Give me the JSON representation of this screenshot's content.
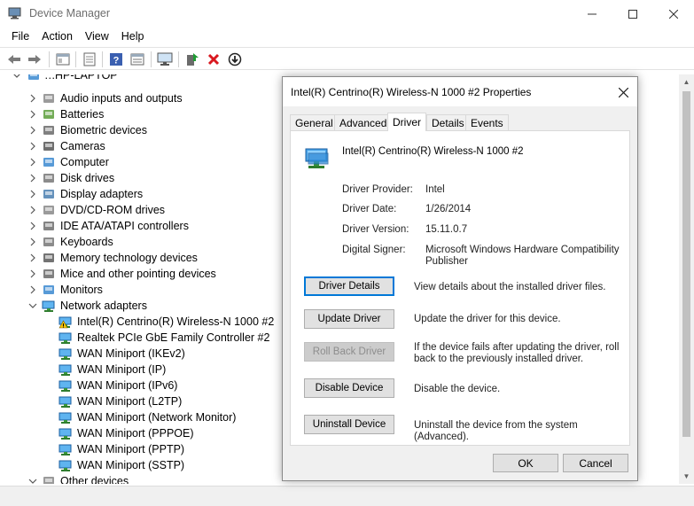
{
  "window": {
    "title": "Device Manager"
  },
  "menu": [
    "File",
    "Action",
    "View",
    "Help"
  ],
  "toolbar_icons": [
    "back-icon",
    "forward-icon",
    "show-hide-icon",
    "properties-icon",
    "help-icon",
    "view-icon",
    "monitor-icon",
    "update-driver-icon",
    "uninstall-icon",
    "disable-icon"
  ],
  "tree": {
    "root": "HP-LAPTOP",
    "root_prefix": "…",
    "categories": [
      {
        "label": "Audio inputs and outputs",
        "icon": "speaker-icon"
      },
      {
        "label": "Batteries",
        "icon": "battery-icon"
      },
      {
        "label": "Biometric devices",
        "icon": "fingerprint-icon"
      },
      {
        "label": "Cameras",
        "icon": "camera-icon"
      },
      {
        "label": "Computer",
        "icon": "computer-icon"
      },
      {
        "label": "Disk drives",
        "icon": "disk-icon"
      },
      {
        "label": "Display adapters",
        "icon": "display-icon"
      },
      {
        "label": "DVD/CD-ROM drives",
        "icon": "dvd-icon"
      },
      {
        "label": "IDE ATA/ATAPI controllers",
        "icon": "ide-icon"
      },
      {
        "label": "Keyboards",
        "icon": "keyboard-icon"
      },
      {
        "label": "Memory technology devices",
        "icon": "memory-icon"
      },
      {
        "label": "Mice and other pointing devices",
        "icon": "mouse-icon"
      },
      {
        "label": "Monitors",
        "icon": "monitor-icon"
      },
      {
        "label": "Network adapters",
        "icon": "network-icon"
      }
    ],
    "network_children": [
      "Intel(R) Centrino(R) Wireless-N 1000 #2",
      "Realtek PCIe GbE Family Controller #2",
      "WAN Miniport (IKEv2)",
      "WAN Miniport (IP)",
      "WAN Miniport (IPv6)",
      "WAN Miniport (L2TP)",
      "WAN Miniport (Network Monitor)",
      "WAN Miniport (PPPOE)",
      "WAN Miniport (PPTP)",
      "WAN Miniport (SSTP)"
    ],
    "last_category": "Other devices"
  },
  "dialog": {
    "title": "Intel(R) Centrino(R) Wireless-N 1000 #2 Properties",
    "tabs": [
      "General",
      "Advanced",
      "Driver",
      "Details",
      "Events"
    ],
    "active_tab": "Driver",
    "device_name": "Intel(R) Centrino(R) Wireless-N 1000 #2",
    "info": {
      "provider_label": "Driver Provider:",
      "provider": "Intel",
      "date_label": "Driver Date:",
      "date": "1/26/2014",
      "version_label": "Driver Version:",
      "version": "15.11.0.7",
      "signer_label": "Digital Signer:",
      "signer": "Microsoft Windows Hardware Compatibility Publisher"
    },
    "buttons": {
      "details": "Driver Details",
      "details_desc": "View details about the installed driver files.",
      "update": "Update Driver",
      "update_desc": "Update the driver for this device.",
      "rollback": "Roll Back Driver",
      "rollback_desc": "If the device fails after updating the driver, roll back to the previously installed driver.",
      "disable": "Disable Device",
      "disable_desc": "Disable the device.",
      "uninstall": "Uninstall Device",
      "uninstall_desc": "Uninstall the device from the system (Advanced).",
      "ok": "OK",
      "cancel": "Cancel"
    }
  },
  "colors": {
    "accent": "#0078d7",
    "warning": "#f5c400",
    "net_icon": "#3c8fd6"
  }
}
